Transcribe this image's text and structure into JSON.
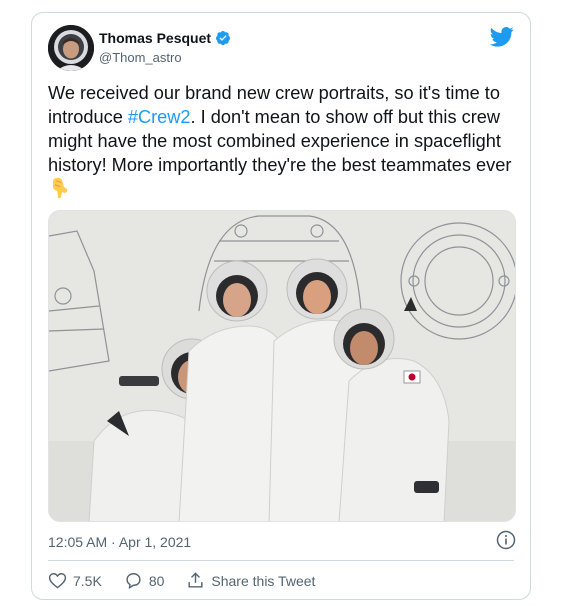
{
  "tweet": {
    "author_name": "Thomas Pesquet",
    "author_handle": "@Thom_astro",
    "text_before": "We received our brand new crew portraits, so it's time to introduce ",
    "hashtag": "#Crew2",
    "text_after": ". I don't mean to show off but this crew might have the most combined experience in spaceflight history! More importantly they're the best teammates ever",
    "emoji": "backhand-index-pointing-down",
    "timestamp": "12:05 AM · Apr 1, 2021"
  },
  "actions": {
    "like_count": "7.5K",
    "reply_count": "80",
    "share_label": "Share this Tweet"
  },
  "colors": {
    "accent": "#1d9bf0",
    "text": "#0f1419",
    "muted": "#536471",
    "border": "#cfd9de"
  },
  "icons": [
    "verified-badge-icon",
    "twitter-bird-icon",
    "info-icon",
    "heart-icon",
    "reply-icon",
    "share-icon"
  ]
}
